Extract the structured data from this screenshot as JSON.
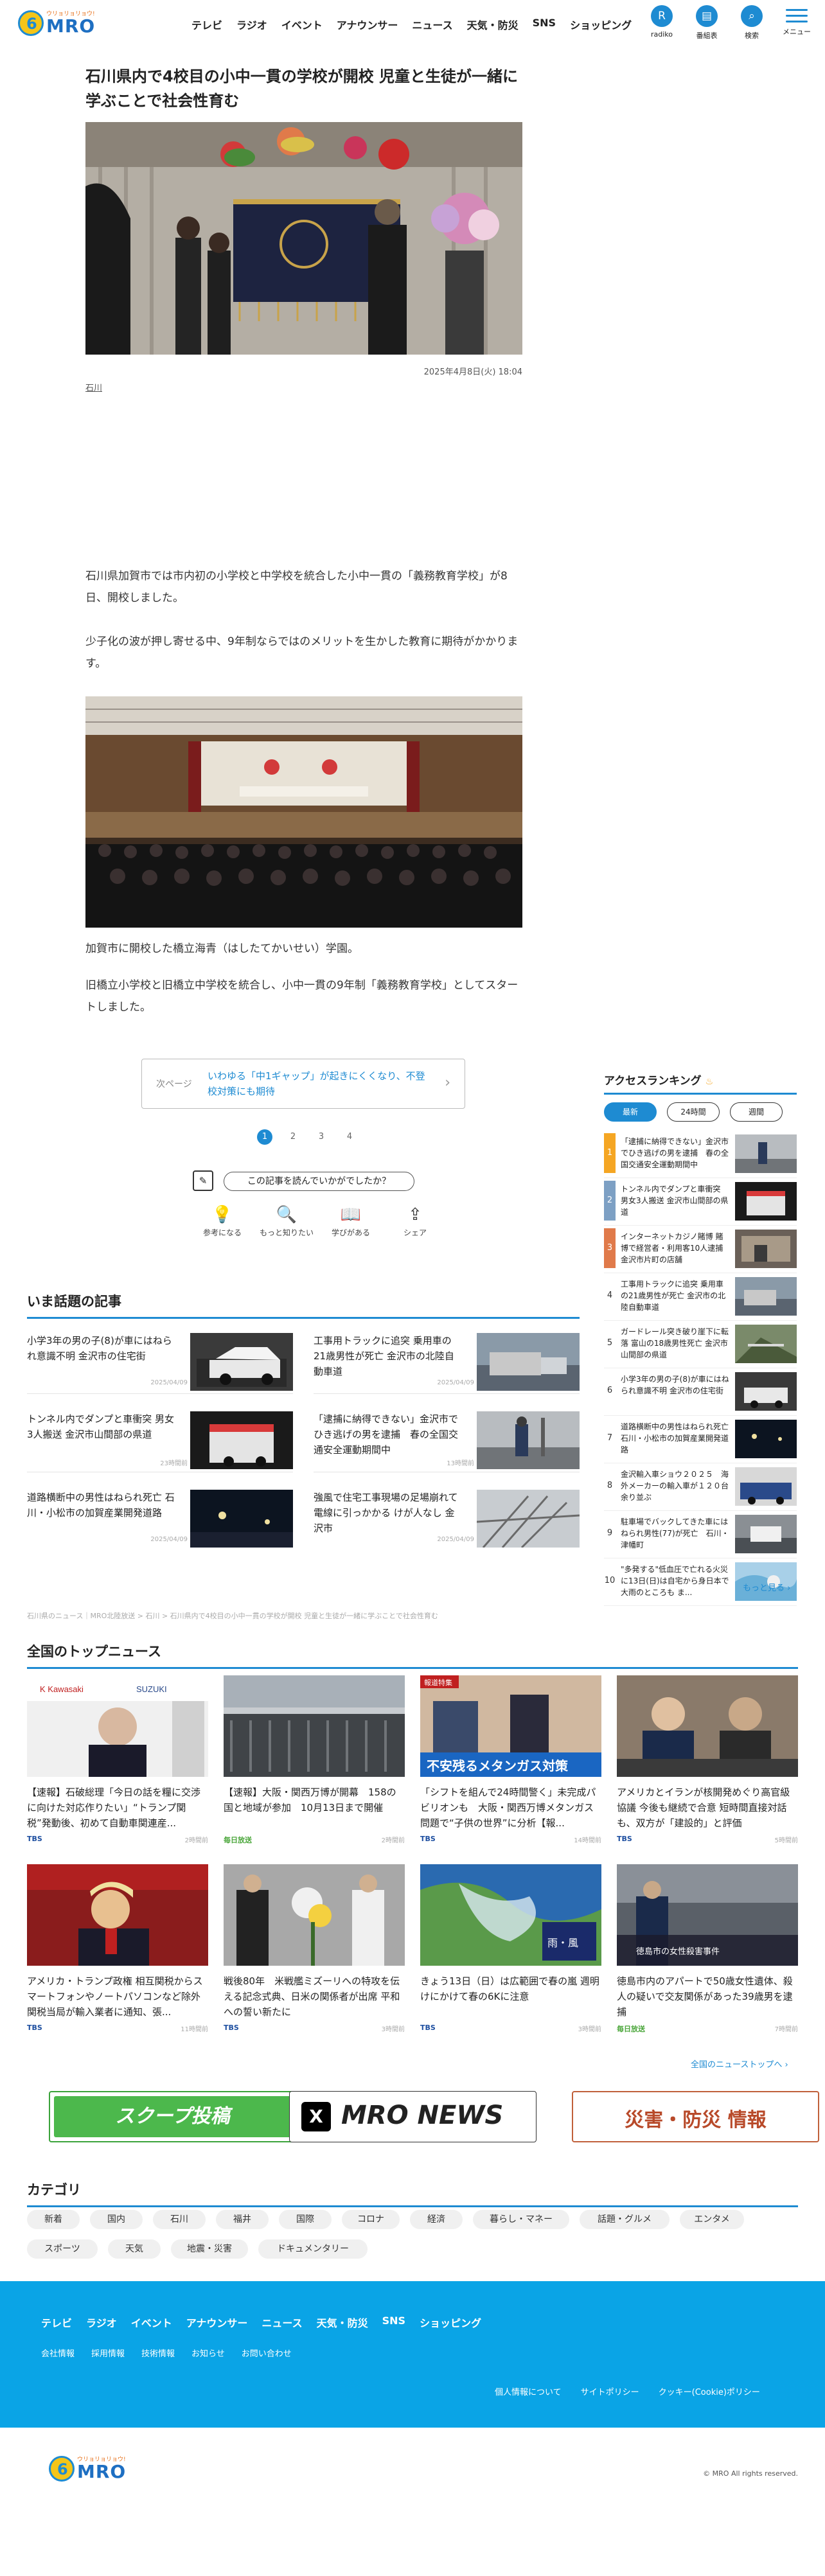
{
  "header": {
    "logo_tag": "ウリョリョリョウ!",
    "logo_text": "MRO",
    "nav": [
      "テレビ",
      "ラジオ",
      "イベント",
      "アナウンサー",
      "ニュース",
      "天気・防災",
      "SNS",
      "ショッピング"
    ],
    "icons": [
      {
        "name": "radiko-icon",
        "glyph": "R",
        "label": "radiko"
      },
      {
        "name": "program-guide-icon",
        "glyph": "▤",
        "label": "番組表"
      },
      {
        "name": "search-icon",
        "glyph": "⌕",
        "label": "検索"
      },
      {
        "name": "menu-icon",
        "glyph": "",
        "label": "メニュー"
      }
    ]
  },
  "article": {
    "title": "石川県内で4校目の小中一貫の学校が開校 児童と生徒が一緒に学ぶことで社会性育む",
    "date": "2025年4月8日(火) 18:04",
    "area": "石川",
    "para1": "石川県加賀市では市内初の小学校と中学校を統合した小中一貫の「義務教育学校」が8日、開校しました。",
    "para2": "少子化の波が押し寄せる中、9年制ならではのメリットを生かした教育に期待がかかります。",
    "photo2_caption": "加賀市に開校した橋立海青（はしたてかいせい）学園。",
    "para3": "旧橋立小学校と旧橋立中学校を統合し、小中一貫の9年制「義務教育学校」としてスタートしました。"
  },
  "next": {
    "label": "次ページ",
    "text": "いわゆる「中1ギャップ」が起きにくくなり、不登校対策にも期待",
    "chevron": "›"
  },
  "pager": [
    "1",
    "2",
    "3",
    "4"
  ],
  "question": {
    "icon": "✎",
    "text": "この記事を読んでいかがでしたか？"
  },
  "reactions": [
    {
      "name": "lightbulb-icon",
      "glyph": "💡",
      "label": "参考になる"
    },
    {
      "name": "magnifier-icon",
      "glyph": "🔍",
      "label": "もっと知りたい"
    },
    {
      "name": "book-icon",
      "glyph": "📖",
      "label": "学びがある"
    },
    {
      "name": "share-icon",
      "glyph": "⇪",
      "label": "シェア"
    }
  ],
  "trending": {
    "heading": "いま話題の記事",
    "items": [
      {
        "title": "小学3年の男の子(8)が車にはねられ意識不明 金沢市の住宅街",
        "date": "2025/04/09"
      },
      {
        "title": "工事用トラックに追突 乗用車の21歳男性が死亡 金沢市の北陸自動車道",
        "date": "2025/04/09"
      },
      {
        "title": "トンネル内でダンプと車衝突 男女3人搬送 金沢市山間部の県道",
        "date": "23時間前"
      },
      {
        "title": "「逮捕に納得できない」金沢市でひき逃げの男を逮捕　春の全国交通安全運動期間中",
        "date": "13時間前"
      },
      {
        "title": "道路横断中の男性はねられ死亡 石川・小松市の加賀産業開発道路",
        "date": "2025/04/09"
      },
      {
        "title": "強風で住宅工事現場の足場崩れて電線に引っかかる けが人なし 金沢市",
        "date": "2025/04/09"
      }
    ]
  },
  "breadcrumb": "石川県のニュース｜MRO北陸放送 > 石川 > 石川県内で4校目の小中一貫の学校が開校 児童と生徒が一緒に学ぶことで社会性育む",
  "ranking": {
    "heading": "アクセスランキング",
    "tabs": [
      "最新",
      "24時間",
      "週間"
    ],
    "items": [
      {
        "rank": "1",
        "title": "「逮捕に納得できない」金沢市でひき逃げの男を逮捕　春の全国交通安全運動期間中"
      },
      {
        "rank": "2",
        "title": "トンネル内でダンプと車衝突 男女3人搬送 金沢市山間部の県道"
      },
      {
        "rank": "3",
        "title": "インターネットカジノ賭博 賭博で経営者・利用客10人逮捕 金沢市片町の店舗"
      },
      {
        "rank": "4",
        "title": "工事用トラックに追突 乗用車の21歳男性が死亡 金沢市の北陸自動車道"
      },
      {
        "rank": "5",
        "title": "ガードレール突き破り崖下に転落 富山の18歳男性死亡 金沢市山間部の県道"
      },
      {
        "rank": "6",
        "title": "小学3年の男の子(8)が車にはねられ意識不明 金沢市の住宅街"
      },
      {
        "rank": "7",
        "title": "道路横断中の男性はねられ死亡 石川・小松市の加賀産業開発道路"
      },
      {
        "rank": "8",
        "title": "金沢輸入車ショウ２０２５　海外メーカーの輸入車が１２０台余り並ぶ"
      },
      {
        "rank": "9",
        "title": "駐車場でバックしてきた車にはねられ男性(77)が死亡　石川・津幡町"
      },
      {
        "rank": "10",
        "title": "\"多発する\"低血圧で亡れる火災に13日(日)は自宅から身日本で大雨のところも ま..."
      }
    ],
    "more": "もっと見る ›"
  },
  "top_news": {
    "heading": "全国のトップニュース",
    "items": [
      {
        "title": "【速報】石破総理「今日の話を糧に交渉に向けた対応作りたい」“トランプ関税”発動後、初めて自動車関連産...",
        "source": "TBS",
        "source_color": "#1e4fa0",
        "date": "2時間前"
      },
      {
        "title": "【速報】大阪・関西万博が開幕　158の国と地域が参加　10月13日まで開催",
        "source": "毎日放送",
        "source_color": "#4aa63a",
        "date": "2時間前"
      },
      {
        "title": "「シフトを組んで24時間警く」未完成パビリオンも　大阪・関西万博メタンガス問題で“子供の世界”に分析【報...",
        "source": "TBS",
        "source_color": "#1e4fa0",
        "date": "14時間前"
      },
      {
        "title": "アメリカとイランが核開発めぐり高官級協議 今後も継続で合意 短時間直接対話も、双方が「建設的」と評価",
        "source": "TBS",
        "source_color": "#1e4fa0",
        "date": "5時間前"
      },
      {
        "title": "アメリカ・トランプ政権 相互関税からスマートフォンやノートパソコンなど除外 関税当局が輸入業者に通知、張...",
        "source": "TBS",
        "source_color": "#1e4fa0",
        "date": "11時間前"
      },
      {
        "title": "戦後80年　米戦艦ミズーリへの特攻を伝える記念式典、日米の関係者が出席 平和への誓い新たに",
        "source": "TBS",
        "source_color": "#1e4fa0",
        "date": "3時間前"
      },
      {
        "title": "きょう13日（日）は広範囲で春の嵐 週明けにかけて春の6Kに注意",
        "source": "TBS",
        "source_color": "#1e4fa0",
        "date": "3時間前"
      },
      {
        "title": "徳島市内のアパートで50歳女性遺体、殺人の疑いで交友関係があった39歳男を逮捕",
        "source": "毎日放送",
        "source_color": "#4aa63a",
        "date": "7時間前"
      }
    ],
    "photo_text": {
      "pavilion": "不安残るメタンガス対策",
      "pavilion_tag": "報道特集",
      "weather": "雨・風",
      "police": "徳島市の女性殺害事件"
    },
    "more": "全国のニューストップへ ›"
  },
  "banners": {
    "scoop": "スクープ投稿",
    "scoop_sub": "MRO",
    "x_glyph": "X",
    "news": "MRO NEWS",
    "disaster": "災害・防災 情報"
  },
  "categories": {
    "heading": "カテゴリ",
    "items": [
      "新着",
      "国内",
      "石川",
      "福井",
      "国際",
      "コロナ",
      "経済",
      "暮らし・マネー",
      "話題・グルメ",
      "エンタメ",
      "スポーツ",
      "天気",
      "地震・災害",
      "ドキュメンタリー"
    ]
  },
  "footer": {
    "nav": [
      "テレビ",
      "ラジオ",
      "イベント",
      "アナウンサー",
      "ニュース",
      "天気・防災",
      "SNS",
      "ショッピング"
    ],
    "sub": [
      "会社情報",
      "採用情報",
      "技術情報",
      "お知らせ",
      "お問い合わせ"
    ],
    "legal": [
      "個人情報について",
      "サイトポリシー",
      "クッキー(Cookie)ポリシー"
    ],
    "copyright": "© MRO All rights reserved."
  },
  "colors": {
    "accent": "#1e8bd2",
    "footer_bg": "#0aa4e6",
    "rank_gold": "#f5a623"
  }
}
